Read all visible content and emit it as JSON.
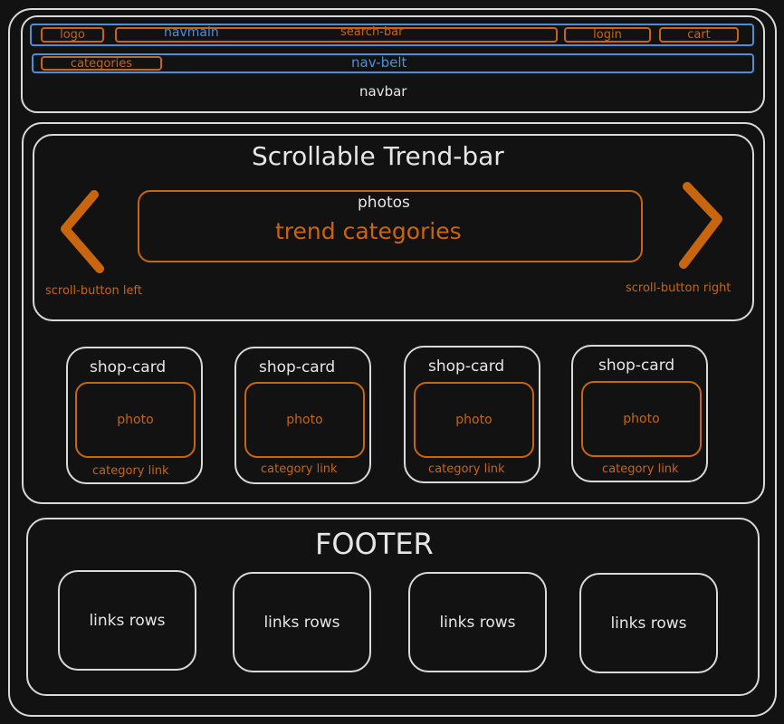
{
  "navbar": {
    "logo": "logo",
    "navmain": "navmain",
    "search_bar": "search-bar",
    "login": "login",
    "cart": "cart",
    "categories": "categories",
    "nav_belt": "nav-belt",
    "label": "navbar"
  },
  "trend": {
    "title": "Scrollable Trend-bar",
    "photos": "photos",
    "categories": "trend categories",
    "scroll_left": "scroll-button left",
    "scroll_right": "scroll-button right"
  },
  "shop_cards": [
    {
      "title": "shop-card",
      "photo": "photo",
      "link": "category link"
    },
    {
      "title": "shop-card",
      "photo": "photo",
      "link": "category link"
    },
    {
      "title": "shop-card",
      "photo": "photo",
      "link": "category link"
    },
    {
      "title": "shop-card",
      "photo": "photo",
      "link": "category link"
    }
  ],
  "footer": {
    "title": "FOOTER",
    "columns": [
      "links rows",
      "links rows",
      "links rows",
      "links rows"
    ]
  },
  "colors": {
    "background": "#121212",
    "outline": "#d9d9d9",
    "accent_orange": "#c8650f",
    "accent_blue": "#4a90d9"
  }
}
